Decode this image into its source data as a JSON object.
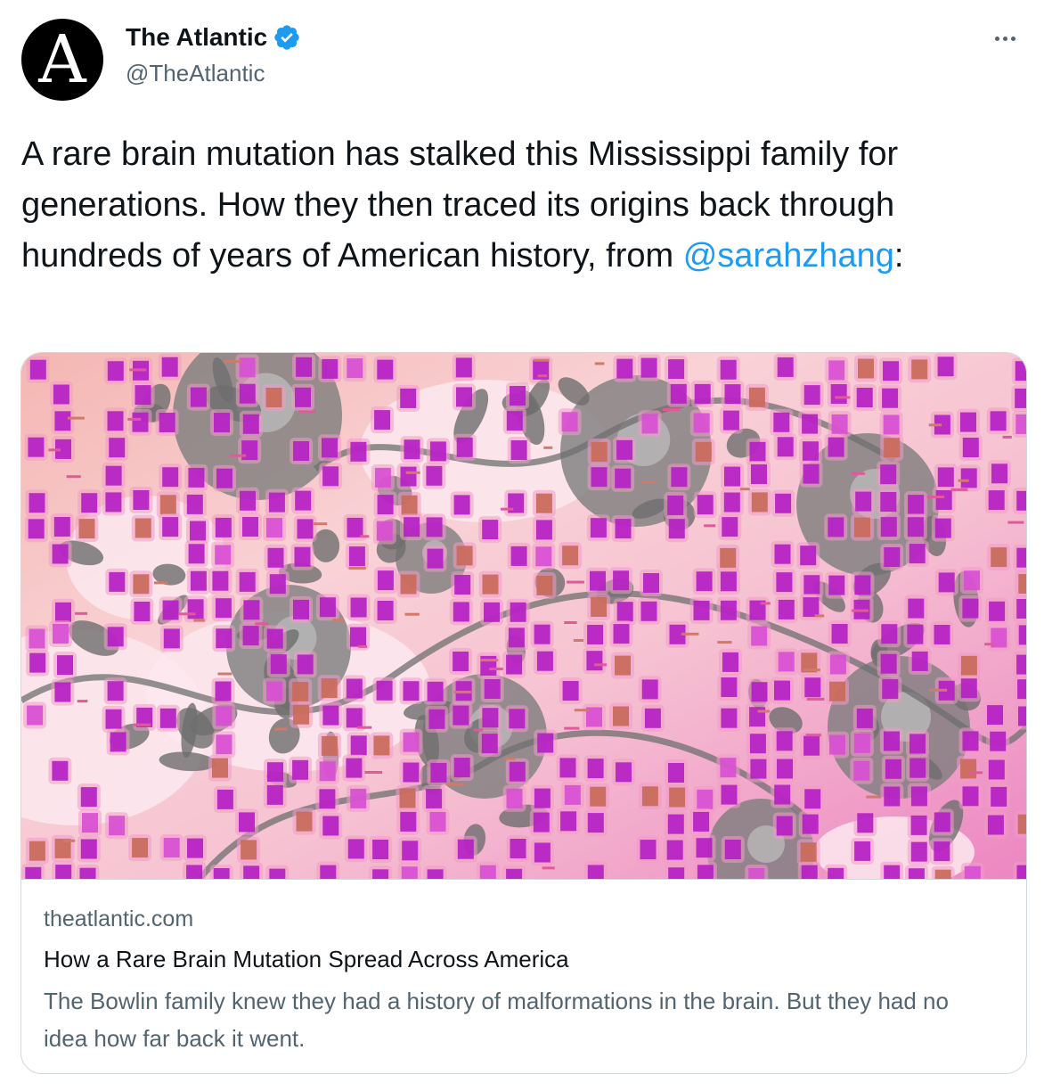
{
  "author": {
    "avatar_letter": "A",
    "name": "The Atlantic",
    "handle": "@TheAtlantic",
    "verified": true
  },
  "tweet": {
    "text_before": "A rare brain mutation has stalked this Mississippi family for generations. How they then traced its origins back through hundreds of years of American history, from ",
    "mention": "@sarahzhang",
    "text_after": ":"
  },
  "card": {
    "domain": "theatlantic.com",
    "title": "How a Rare Brain Mutation Spread Across America",
    "description": "The Bowlin family knew they had a history of malformations in the brain. But they had no idea how far back it went."
  },
  "icons": {
    "verified": "verified-badge-icon",
    "more": "more-options-icon"
  },
  "colors": {
    "link": "#1d9bf0",
    "secondary_text": "#536471",
    "verified": "#1d9bf0",
    "image_magenta": "#b51fc4",
    "image_pink": "#f19ac8",
    "image_salmon": "#f2b3a4",
    "image_gray": "#7d7d7d"
  }
}
